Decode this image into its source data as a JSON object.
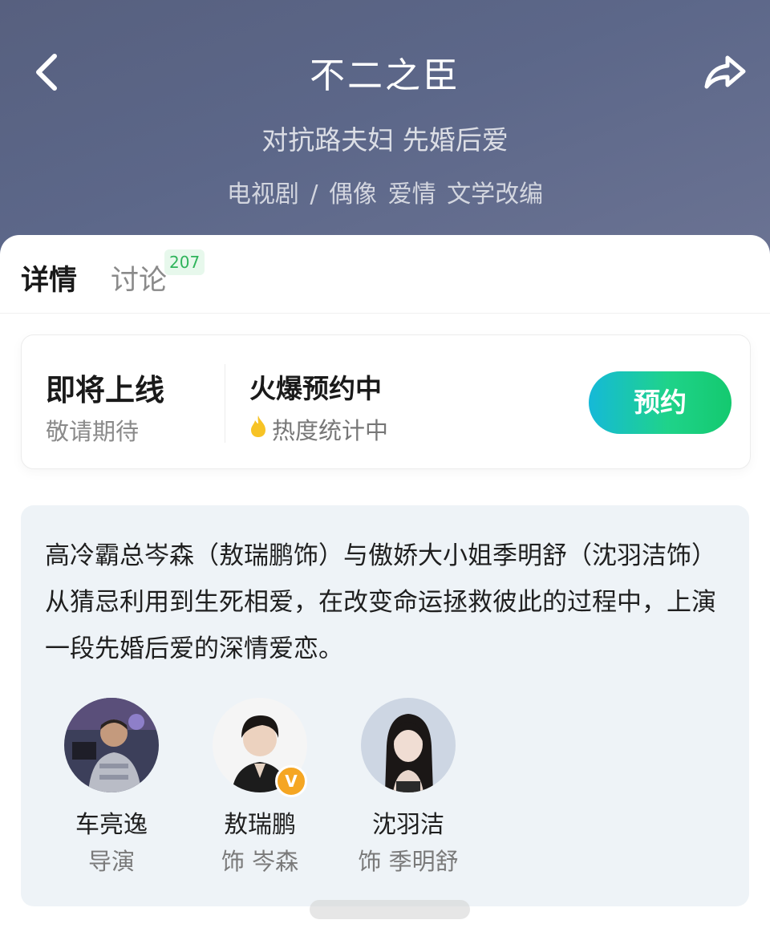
{
  "header": {
    "title": "不二之臣",
    "subtitle": "对抗路夫妇 先婚后爱",
    "genres": "电视剧 / 偶像 爱情 文学改编"
  },
  "tabs": [
    {
      "label": "详情",
      "active": true
    },
    {
      "label": "讨论",
      "badge": "207"
    }
  ],
  "release": {
    "status_title": "即将上线",
    "status_sub": "敬请期待",
    "hot_title": "火爆预约中",
    "hot_sub": "热度统计中",
    "reserve_label": "预约"
  },
  "synopsis": "高冷霸总岑森（敖瑞鹏饰）与傲娇大小姐季明舒（沈羽洁饰）从猜忌利用到生死相爱，在改变命运拯救彼此的过程中，上演一段先婚后爱的深情爱恋。",
  "cast": [
    {
      "name": "车亮逸",
      "role": "导演"
    },
    {
      "name": "敖瑞鹏",
      "role": "饰 岑森",
      "verified": true
    },
    {
      "name": "沈羽洁",
      "role": "饰 季明舒"
    }
  ],
  "colors": {
    "header_bg": "#5c6789",
    "accent_green": "#1fd38a",
    "accent_cyan": "#15b9d8",
    "badge_text": "#2fb45b",
    "intro_bg": "#eef3f7",
    "verified": "#f5a623"
  }
}
